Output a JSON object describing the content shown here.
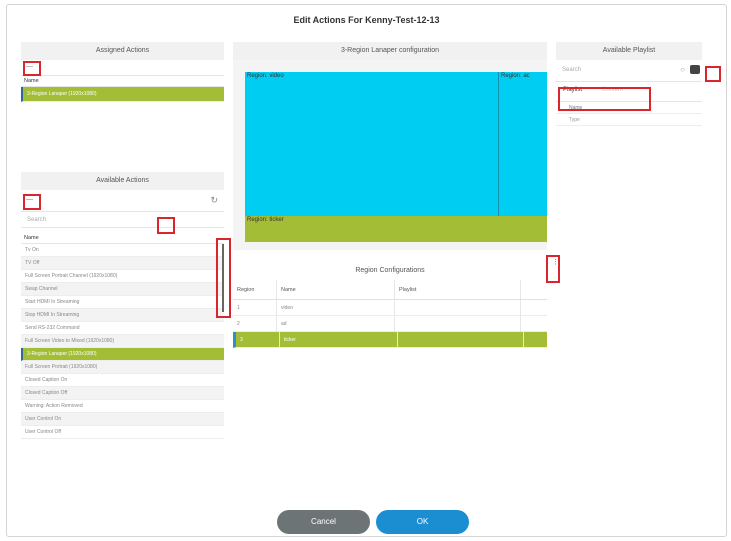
{
  "dialog": {
    "title": "Edit Actions For Kenny-Test-12-13"
  },
  "assigned": {
    "title": "Assigned Actions",
    "collapse_label": "—",
    "column": "Name",
    "rows": [
      "3-Region Lanaper (1920x1080)"
    ]
  },
  "available": {
    "title": "Available Actions",
    "collapse_label": "—",
    "refresh_icon": "refresh-icon",
    "search_placeholder": "Search",
    "column": "Name",
    "rows": [
      "Tv On",
      "TV Off",
      "Full Screen Portrait Channel (1920x1080)",
      "Swap Channel",
      "Start HDMI In Streaming",
      "Stop HDMI In Streaming",
      "Send RS-232 Command",
      "Full Screen Video to Mixed (1920x1080)",
      "3-Region Lanaper (1920x1080)",
      "Full Screen Portrait (1920x1080)",
      "Closed Caption On",
      "Closed Caption Off",
      "Warning: Action Removed",
      "User Control On",
      "User Control Off"
    ],
    "selected_index": 8
  },
  "layout": {
    "title": "3-Region Lanaper configuration",
    "regions": [
      "Region: video",
      "Region: ac",
      "Region: ticker"
    ]
  },
  "regioncfg": {
    "title": "Region Configurations",
    "columns": [
      "Region",
      "Name",
      "Playlist"
    ],
    "rows": [
      [
        "1",
        "video",
        ""
      ],
      [
        "2",
        "ad",
        ""
      ],
      [
        "3",
        "ticker",
        ""
      ]
    ],
    "selected_index": 2
  },
  "playlist": {
    "title": "Available Playlist",
    "search_placeholder": "Search",
    "tabs": [
      "Playlist",
      "Content"
    ],
    "columns": [
      "Name",
      "Type"
    ]
  },
  "buttons": {
    "cancel": "Cancel",
    "ok": "OK"
  },
  "colors": {
    "accent_green": "#a4bd36",
    "region_cyan": "#00cdf2",
    "ok_blue": "#1b8ed1",
    "highlight_red": "#d9262c"
  }
}
